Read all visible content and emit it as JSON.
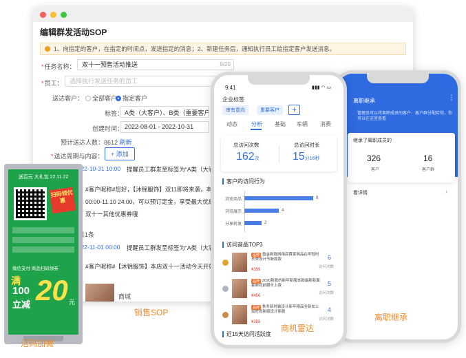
{
  "sop": {
    "title": "编辑群发活动SOP",
    "notice": "1、向指定的客户，在指定的时间点，发送指定的消息；2、新建任务后，通知执行员工给指定客户发送消息。",
    "task_name_label": "任务名称：",
    "task_name_value": "双十一预售活动推送",
    "task_name_count": "9/20",
    "staff_label": "员工：",
    "staff_placeholder": "选择执行发送任务的员工",
    "target_label": "送达客户：",
    "radio_all": "全部客户",
    "radio_specified": "指定客户",
    "tags_label": "标签：",
    "tags_value": "A类（大客户）、B类（重要客户）",
    "created_label": "创建时间：",
    "created_value": "2022-08-01 - 2022-10-31",
    "estimate_label": "预计送达人数：",
    "estimate_value": "8612",
    "refresh": "刷新",
    "period_label": "送达周期与内容：",
    "add_button": "+ 添加",
    "seq1_time": "2022-10-31 10:00",
    "seq1_text": "提醒员工群发至标签为“A类（大客",
    "msg1_line1": "#客户昵称#您好，【沐锦服饰】双11即将来袭，本",
    "msg1_line2": "00:00-11.10 24:00，可以预订定金，享受最大优惠",
    "msg1_line3": "双十一其他优惠券哦",
    "seq2_label": "共1条",
    "seq2_time": "2022-11-01 00:00",
    "seq2_text": "提醒员工群发至标签为“A类（大客",
    "msg2_line1": "#客户昵称#【沐锦服饰】本店双十一活动今天开始啦",
    "product_label": "商城",
    "caption": "销售SOP"
  },
  "poster": {
    "top_text": "送百元 大礼包 22.11.22",
    "ribbon": "扫码领优惠",
    "pay_text": "微信支付  商品扫码领券",
    "man": "满",
    "amount1": "100",
    "li_jian": "立减",
    "amount2": "20",
    "yuan": "元",
    "caption": "活码加微"
  },
  "phone1": {
    "time": "9:41",
    "signal": "▮▮▮ ◠ ▭",
    "tags_title": "企业标签",
    "chip1": "审有意向",
    "chip2": "重要客户",
    "plus": "+",
    "tabs": [
      "动态",
      "分析",
      "基础",
      "车辆",
      "消费"
    ],
    "stat1_label": "总访问次数",
    "stat1_value": "162",
    "stat1_unit": "次",
    "stat2_label": "总访问时长",
    "stat2_value": "15",
    "stat2_unit": "分16秒",
    "behavior_title": "客户的访问行为",
    "bars": [
      {
        "label": "浏览商品",
        "value": 8
      },
      {
        "label": "浏览展示",
        "value": 4
      },
      {
        "label": "分享转发",
        "value": 2
      }
    ],
    "top3_title": "访问商品TOP3",
    "products": [
      {
        "badge": "品牌",
        "text": "重金新款网络店首家商品在年轻时长秀设计节新款款",
        "price": "¥359",
        "count": "6",
        "count_label": "访问次数"
      },
      {
        "badge": "品牌",
        "text": "2020新款的新年新服本款最新新面套新花前朝长上款",
        "price": "¥456",
        "count": "5",
        "count_label": "访问次数"
      },
      {
        "badge": "品牌",
        "text": "秋冬新时装设计新年精品全新女士如时尚新版设计新款",
        "price": "¥359",
        "count": "4",
        "count_label": "访问次数"
      }
    ],
    "trend_title": "近15天访问活跃度",
    "caption": "商机雷达"
  },
  "phone2": {
    "title": "离职继承",
    "menu": "⋮",
    "info": "管理员可以将离职成员的客户、客户群分配给你，你可以在这里查看",
    "card_title": "继承了离职成员的",
    "n1": "326",
    "n1_label": "客户",
    "n2": "16",
    "n2_label": "客户群",
    "link": "看详情",
    "caption": "离职继承"
  },
  "colors": {
    "accent": "#2f6fe0",
    "orange": "#ef8a2a",
    "poster_green": "#1ea24a",
    "dot_red": "#f25f58",
    "dot_yellow": "#fbbe2e",
    "dot_green": "#3cc840"
  }
}
